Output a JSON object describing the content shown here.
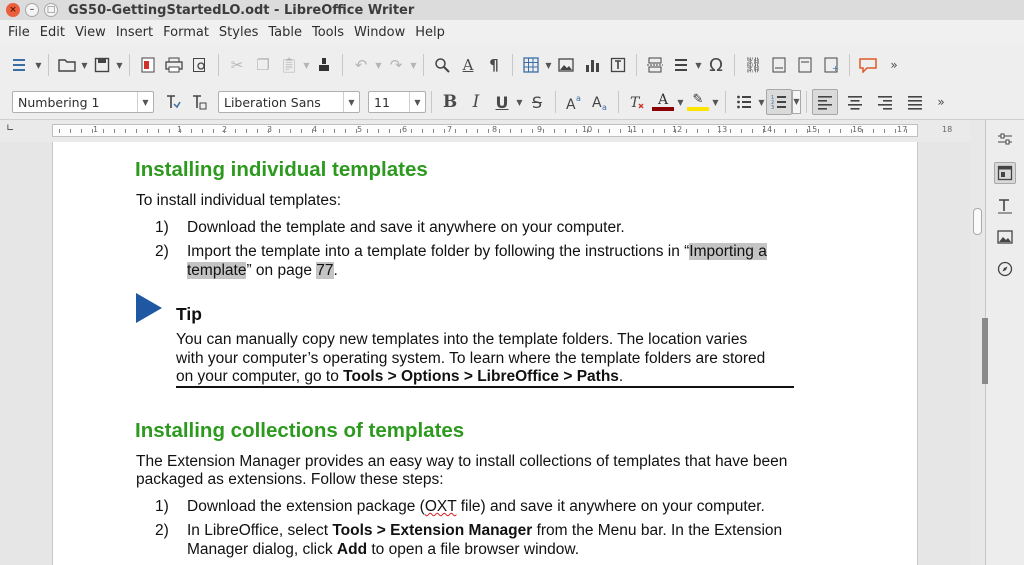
{
  "window": {
    "title": "GS50-GettingStartedLO.odt - LibreOffice Writer",
    "close_glyph": "×",
    "min_glyph": "–",
    "max_glyph": "□"
  },
  "menu": [
    "File",
    "Edit",
    "View",
    "Insert",
    "Format",
    "Styles",
    "Table",
    "Tools",
    "Window",
    "Help"
  ],
  "toolbar2": {
    "paragraph_style": "Numbering 1",
    "font_name": "Liberation Sans",
    "font_size": "11",
    "bold_glyph": "B",
    "italic_glyph": "I",
    "underline_glyph": "U",
    "strike_glyph": "S"
  },
  "ruler": {
    "numbers": [
      "1",
      "1",
      "2",
      "3",
      "4",
      "5",
      "6",
      "7",
      "8",
      "9",
      "10",
      "11",
      "12",
      "13",
      "14",
      "15",
      "16",
      "17",
      "18"
    ]
  },
  "document": {
    "heading1": "Installing individual templates",
    "intro1": "To install individual templates:",
    "list1": [
      {
        "num": "1)",
        "text": "Download the template and save it anywhere on your computer."
      },
      {
        "num": "2)",
        "text_a": "Import the template into a template folder by following the instructions in “",
        "link": "Importing a",
        "link2": "template",
        "text_b": "” on page ",
        "page": "77",
        "text_c": "."
      }
    ],
    "tip": {
      "title": "Tip",
      "line1": "You can manually copy new templates into the template folders. The location varies",
      "line2": "with your computer’s operating system. To learn where the template folders are stored",
      "line3_a": "on your computer, go to ",
      "line3_bold": "Tools > Options > LibreOffice > Paths",
      "line3_b": "."
    },
    "heading2": "Installing collections of templates",
    "intro2_line1": "The Extension Manager provides an easy way to install collections of templates that have been",
    "intro2_line2": "packaged as extensions. Follow these steps:",
    "list2": [
      {
        "num": "1)",
        "text_a": "Download the extension package (",
        "squiggle": "OXT",
        "text_b": " file) and save it anywhere on your computer."
      },
      {
        "num": "2)",
        "line1_a": "In LibreOffice, select ",
        "line1_bold": "Tools > Extension Manager",
        "line1_b": " from the Menu bar. In the Extension",
        "line2_a": "Manager dialog, click ",
        "line2_bold": "Add",
        "line2_b": " to open a file browser window."
      }
    ]
  },
  "colors": {
    "heading": "#2d9a1f",
    "tip_icon": "#1f57a3",
    "font_color_bar": "#8b0000",
    "highlight_bar": "#ffe600"
  }
}
